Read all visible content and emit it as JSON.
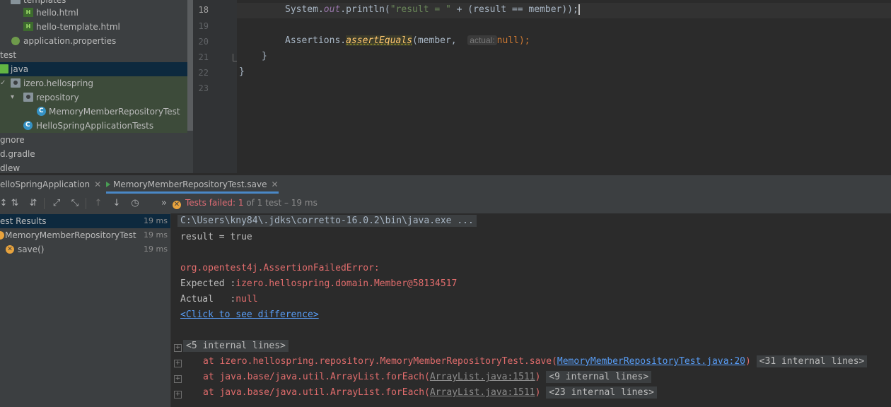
{
  "project_tree": [
    {
      "label": "templates",
      "icon": "folder-icon"
    },
    {
      "label": "hello.html",
      "icon": "html-file-icon"
    },
    {
      "label": "hello-template.html",
      "icon": "html-file-icon"
    },
    {
      "label": "application.properties",
      "icon": "settings-file-icon"
    },
    {
      "label": "test",
      "icon": ""
    },
    {
      "label": "java",
      "icon": "folder-green-icon"
    },
    {
      "label": "izero.hellospring",
      "icon": "package-icon"
    },
    {
      "label": "repository",
      "icon": "package-icon"
    },
    {
      "label": "MemoryMemberRepositoryTest",
      "icon": "class-icon"
    },
    {
      "label": "HelloSpringApplicationTests",
      "icon": "class-icon"
    },
    {
      "label": "gnore",
      "icon": ""
    },
    {
      "label": "d.gradle",
      "icon": ""
    },
    {
      "label": "dlew",
      "icon": ""
    }
  ],
  "editor": {
    "line_numbers": [
      "18",
      "19",
      "20",
      "21",
      "22",
      "23"
    ],
    "line18": {
      "obj": "System.",
      "field": "out",
      "call": ".println(",
      "str": "\"result = \"",
      "rest": " + (result == member));"
    },
    "line20": {
      "obj": "Assertions.",
      "method": "assertEquals",
      "open": "(member, ",
      "hint": "actual:",
      "null": "null",
      "close": ");"
    },
    "line21": "}",
    "line22": "}"
  },
  "run_tabs": [
    {
      "label": "elloSpringApplication"
    },
    {
      "label": "MemoryMemberRepositoryTest.save"
    }
  ],
  "status": {
    "prefix": "Tests failed:",
    "count": "1",
    "suffix": "of 1 test – 19 ms"
  },
  "results": [
    {
      "label": "est Results",
      "time": "19 ms"
    },
    {
      "label": "MemoryMemberRepositoryTest",
      "time": "19 ms"
    },
    {
      "label": "save()",
      "time": "19 ms"
    }
  ],
  "console": {
    "cmd": "C:\\Users\\kny84\\.jdks\\corretto-16.0.2\\bin\\java.exe ...",
    "out1": "result = true",
    "error": "org.opentest4j.AssertionFailedError:",
    "expected_label": "Expected :",
    "expected_value": "izero.hellospring.domain.Member@58134517",
    "actual_label": "Actual   :",
    "actual_value": "null",
    "diff_link": "<Click to see difference>",
    "fold1": "<5 internal lines>",
    "trace": [
      {
        "at": "at izero.hellospring.repository.MemoryMemberRepositoryTest.save(",
        "link": "MemoryMemberRepositoryTest.java:20",
        "close": ")",
        "fold": "<31 internal lines>"
      },
      {
        "at": "at java.base/java.util.ArrayList.forEach(",
        "link": "ArrayList.java:1511",
        "close": ")",
        "fold": "<9 internal lines>"
      },
      {
        "at": "at java.base/java.util.ArrayList.forEach(",
        "link": "ArrayList.java:1511",
        "close": ")",
        "fold": "<23 internal lines>"
      }
    ]
  }
}
